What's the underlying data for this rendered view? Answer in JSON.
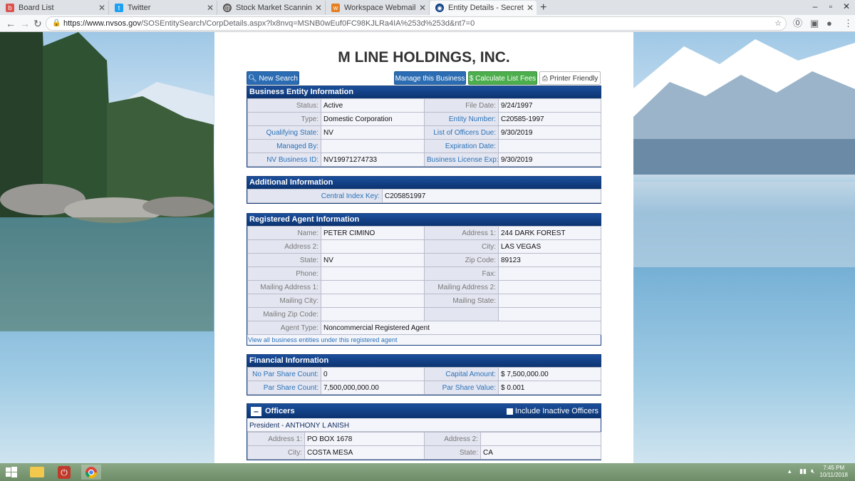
{
  "browser": {
    "tabs": [
      {
        "title": "Board List",
        "icon": "board-icon",
        "active": false
      },
      {
        "title": "Twitter",
        "icon": "twitter-icon",
        "active": false
      },
      {
        "title": "Stock Market Scanning, Online V",
        "icon": "stock-icon",
        "active": false
      },
      {
        "title": "Workspace Webmail :: Mail Index",
        "icon": "mail-icon",
        "active": false
      },
      {
        "title": "Entity Details - Secretary of State",
        "icon": "nvsos-icon",
        "active": true
      }
    ],
    "url_host": "https://www.nvsos.gov",
    "url_path": "/SOSEntitySearch/CorpDetails.aspx?lx8nvq=MSNB0wEuf0FC98KJLRa4IA%253d%253d&nt7=0"
  },
  "page": {
    "title": "M LINE HOLDINGS, INC.",
    "buttons": {
      "new_search": "New Search",
      "manage": "Manage this Business",
      "calculate": "Calculate List Fees",
      "printer": "Printer Friendly"
    },
    "business_entity": {
      "header": "Business Entity Information",
      "rows": [
        {
          "l1": "Status:",
          "v1": "Active",
          "l2": "File Date:",
          "v2": "9/24/1997"
        },
        {
          "l1": "Type:",
          "v1": "Domestic Corporation",
          "l2": "Entity Number:",
          "v2": "C20585-1997"
        },
        {
          "l1": "Qualifying State:",
          "v1": "NV",
          "l2": "List of Officers Due:",
          "v2": "9/30/2019"
        },
        {
          "l1": "Managed By:",
          "v1": "",
          "l2": "Expiration Date:",
          "v2": ""
        },
        {
          "l1": "NV Business ID:",
          "v1": "NV19971274733",
          "l2": "Business License Exp:",
          "v2": "9/30/2019"
        }
      ]
    },
    "additional": {
      "header": "Additional Information",
      "label": "Central Index Key:",
      "value": "C205851997"
    },
    "registered_agent": {
      "header": "Registered Agent Information",
      "rows": [
        {
          "l1": "Name:",
          "v1": "PETER CIMINO",
          "l2": "Address 1:",
          "v2": "244 DARK FOREST"
        },
        {
          "l1": "Address 2:",
          "v1": "",
          "l2": "City:",
          "v2": "LAS VEGAS"
        },
        {
          "l1": "State:",
          "v1": "NV",
          "l2": "Zip Code:",
          "v2": "89123"
        },
        {
          "l1": "Phone:",
          "v1": "",
          "l2": "Fax:",
          "v2": ""
        },
        {
          "l1": "Mailing Address 1:",
          "v1": "",
          "l2": "Mailing Address 2:",
          "v2": ""
        },
        {
          "l1": "Mailing City:",
          "v1": "",
          "l2": "Mailing State:",
          "v2": ""
        },
        {
          "l1": "Mailing Zip Code:",
          "v1": "",
          "l2": "",
          "v2": ""
        }
      ],
      "agent_type_label": "Agent Type:",
      "agent_type_value": "Noncommercial Registered Agent",
      "view_all_link": "View all business entities under this registered agent"
    },
    "financial": {
      "header": "Financial Information",
      "rows": [
        {
          "l1": "No Par Share Count:",
          "v1": "0",
          "l2": "Capital Amount:",
          "v2": "$ 7,500,000.00"
        },
        {
          "l1": "Par Share Count:",
          "v1": "7,500,000,000.00",
          "l2": "Par Share Value:",
          "v2": "$ 0.001"
        }
      ]
    },
    "officers": {
      "header": "Officers",
      "include_inactive": "Include Inactive Officers",
      "officer_title": "President - ANTHONY L ANISH",
      "rows": [
        {
          "l1": "Address 1:",
          "v1": "PO BOX 1678",
          "l2": "Address 2:",
          "v2": ""
        },
        {
          "l1": "City:",
          "v1": "COSTA MESA",
          "l2": "State:",
          "v2": "CA"
        }
      ]
    }
  },
  "taskbar": {
    "time": "7:45 PM",
    "date": "10/11/2018"
  }
}
